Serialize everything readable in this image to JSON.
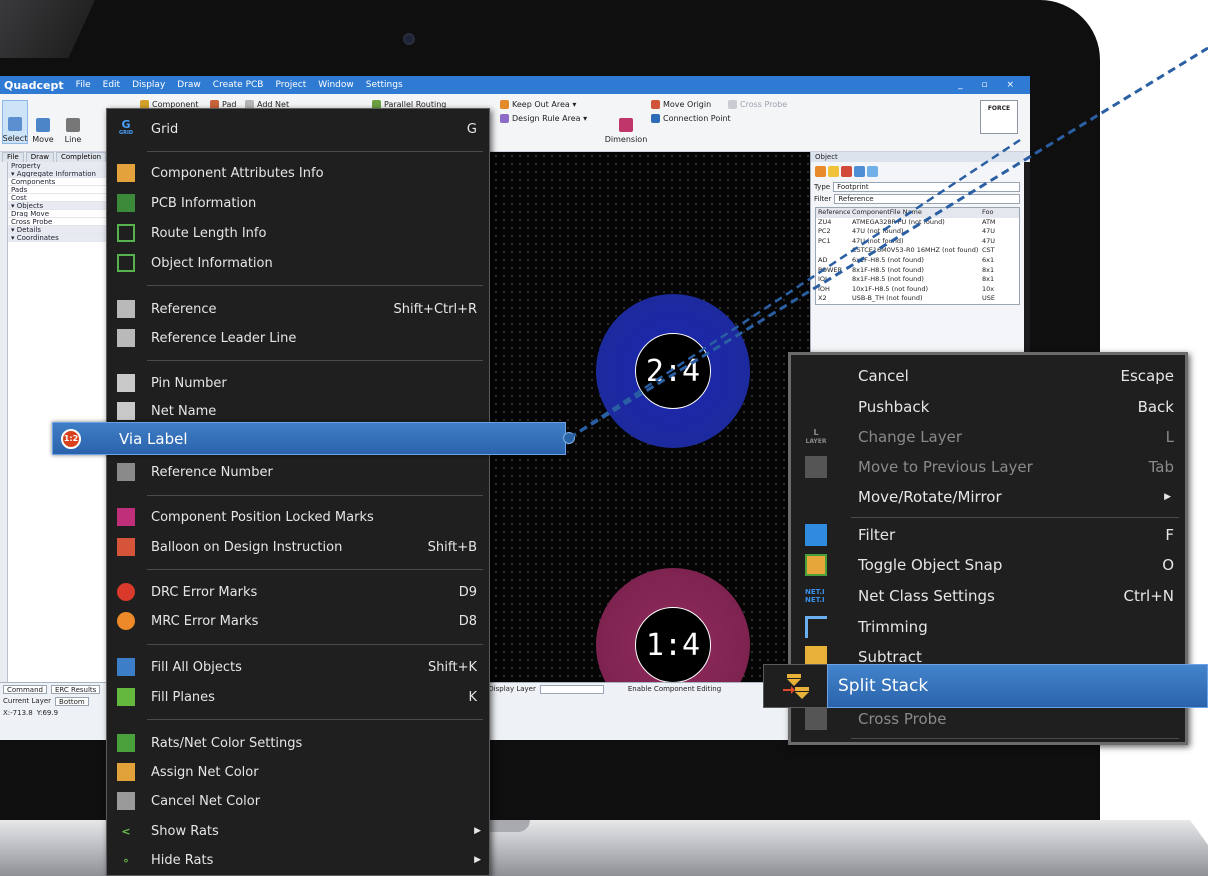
{
  "app": {
    "logo": "Quadcept",
    "menus": [
      "File",
      "Edit",
      "Display",
      "Draw",
      "Create PCB",
      "Project",
      "Window",
      "Settings"
    ],
    "window_controls": "_ ▫ ×"
  },
  "ribbon": {
    "select": "Select",
    "move": "Move",
    "line": "Line",
    "component": "Component",
    "pad": "Pad",
    "add_net": "Add Net",
    "parallel_routing": "Parallel Routing",
    "keep_out_area": "Keep Out Area ▾",
    "design_rule_area": "Design Rule Area ▾",
    "dimension": "Dimension",
    "move_origin": "Move Origin",
    "connection_point": "Connection Point",
    "cross_probe": "Cross Probe",
    "force": "FORCE"
  },
  "doc_tabs": [
    "File",
    "Draw",
    "Completion"
  ],
  "property_panel": {
    "title": "Property",
    "rows": [
      "▾ Aggregate Information",
      "Components",
      "Pads",
      "Cost",
      "▾ Objects",
      "Drag Move",
      "Cross Probe",
      "▾ Details",
      "▾ Coordinates"
    ]
  },
  "canvas": {
    "via_top_label": "2:4",
    "via_bottom_label": "1:4"
  },
  "object_panel": {
    "title": "Object",
    "type_label": "Type",
    "type_value": "Footprint",
    "filter_label": "Filter",
    "filter_value": "Reference",
    "columns": [
      "Reference",
      "ComponentFile Name",
      "Foo"
    ],
    "rows": [
      [
        "ZU4",
        "ATMEGA328P-PU (not found)",
        "ATM"
      ],
      [
        "PC2",
        "47U (not found)",
        "47U"
      ],
      [
        "PC1",
        "47U (not found)",
        "47U"
      ],
      [
        "",
        "CSTCE16M0V53-R0 16MHZ (not found)",
        "CST"
      ],
      [
        "AD",
        "6x1F-H8.5 (not found)",
        "6x1"
      ],
      [
        "POWER",
        "8x1F-H8.5 (not found)",
        "8x1"
      ],
      [
        "IOL",
        "8x1F-H8.5 (not found)",
        "8x1"
      ],
      [
        "IOH",
        "10x1F-H8.5 (not found)",
        "10x"
      ],
      [
        "X2",
        "USB-B_TH (not found)",
        "USE"
      ]
    ]
  },
  "bottom_panel": {
    "tabs": [
      "Command",
      "ERC Results"
    ],
    "current_layer_label": "Current Layer",
    "current_layer_value": "Bottom",
    "coord_x": "X:-713.8",
    "coord_y": "Y:69.9",
    "display_layer_label": "Display Layer",
    "enable_component_editing": "Enable Component Editing"
  },
  "view_menu": {
    "items": [
      {
        "label": "Grid",
        "shortcut": "G",
        "icon": "grid-icon"
      },
      {
        "label": "Component Attributes Info",
        "shortcut": "",
        "icon": "component-attributes-icon"
      },
      {
        "label": "PCB Information",
        "shortcut": "",
        "icon": "pcb-information-icon"
      },
      {
        "label": "Route Length Info",
        "shortcut": "",
        "icon": "route-length-icon"
      },
      {
        "label": "Object Information",
        "shortcut": "",
        "icon": "object-information-icon"
      },
      {
        "label": "Reference",
        "shortcut": "Shift+Ctrl+R",
        "icon": "reference-icon"
      },
      {
        "label": "Reference Leader Line",
        "shortcut": "",
        "icon": "reference-leader-icon"
      },
      {
        "label": "Pin Number",
        "shortcut": "",
        "icon": "pin-number-icon"
      },
      {
        "label": "Net Name",
        "shortcut": "",
        "icon": "net-name-icon"
      },
      {
        "label": "Reference Number",
        "shortcut": "",
        "icon": "reference-number-icon"
      },
      {
        "label": "Component Position Locked Marks",
        "shortcut": "",
        "icon": "lock-marks-icon"
      },
      {
        "label": "Balloon on Design Instruction",
        "shortcut": "Shift+B",
        "icon": "balloon-icon"
      },
      {
        "label": "DRC Error Marks",
        "shortcut": "D9",
        "icon": "drc-error-icon"
      },
      {
        "label": "MRC Error Marks",
        "shortcut": "D8",
        "icon": "mrc-error-icon"
      },
      {
        "label": "Fill All Objects",
        "shortcut": "Shift+K",
        "icon": "fill-all-icon"
      },
      {
        "label": "Fill Planes",
        "shortcut": "K",
        "icon": "fill-planes-icon"
      },
      {
        "label": "Rats/Net Color Settings",
        "shortcut": "",
        "icon": "rats-net-color-icon"
      },
      {
        "label": "Assign Net Color",
        "shortcut": "",
        "icon": "assign-net-color-icon"
      },
      {
        "label": "Cancel Net Color",
        "shortcut": "",
        "icon": "cancel-net-color-icon"
      },
      {
        "label": "Show Rats",
        "shortcut": "",
        "icon": "show-rats-icon"
      },
      {
        "label": "Hide Rats",
        "shortcut": "",
        "icon": "hide-rats-icon"
      }
    ],
    "highlighted": {
      "label": "Via Label",
      "icon": "via-label-icon",
      "icon_text": "1:2"
    }
  },
  "edit_menu": {
    "items": [
      {
        "label": "Cancel",
        "shortcut": "Escape"
      },
      {
        "label": "Pushback",
        "shortcut": "Back"
      },
      {
        "label": "Change Layer",
        "shortcut": "L"
      },
      {
        "label": "Move to Previous Layer",
        "shortcut": "Tab"
      },
      {
        "label": "Move/Rotate/Mirror",
        "shortcut": ""
      },
      {
        "label": "Filter",
        "shortcut": "F"
      },
      {
        "label": "Toggle Object Snap",
        "shortcut": "O"
      },
      {
        "label": "Net Class Settings",
        "shortcut": "Ctrl+N"
      },
      {
        "label": "Trimming",
        "shortcut": ""
      },
      {
        "label": "Subtract",
        "shortcut": ""
      },
      {
        "label": "Cross Probe",
        "shortcut": ""
      }
    ],
    "highlighted": {
      "label": "Split Stack",
      "icon": "split-stack-icon"
    }
  },
  "icon_text": {
    "grid": "G",
    "grid_sub": "GRID",
    "layer": "L",
    "layer_sub": "LAYER",
    "netclass": "NET.I NET.I"
  },
  "colors": {
    "accent": "#2f7bd4",
    "highlight": "#3673bd",
    "menu_bg": "#1f1f1f",
    "via_blue": "#1d2a9e",
    "via_red": "#7e2350"
  }
}
